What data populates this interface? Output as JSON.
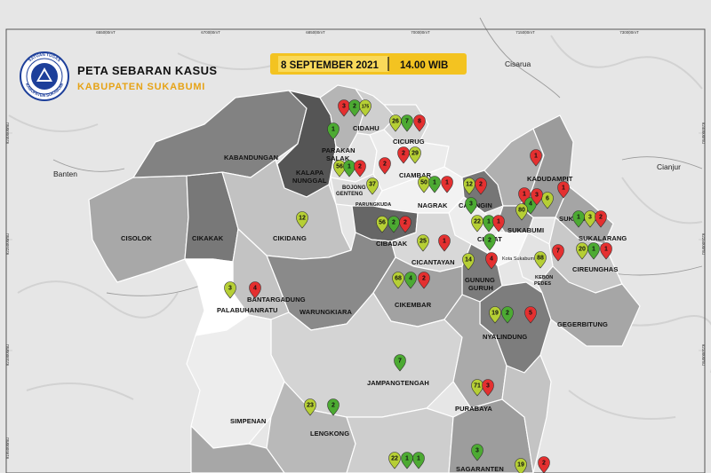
{
  "header": {
    "title": "PETA SEBARAN KASUS",
    "subtitle": "KABUPATEN SUKABUMI",
    "date": "8 SEPTEMBER 2021",
    "time": "14.00 WIB"
  },
  "logo": {
    "ring_text_top": "SATUAN TUGAS",
    "ring_text_bottom": "KABUPATEN SUKABUMI"
  },
  "colors": {
    "pin_red": "#e43030",
    "pin_green": "#4caa32",
    "pin_yellowgreen": "#b6cf35",
    "accent_gold": "#f3c321",
    "logo_blue": "#1d3f9a"
  },
  "grid": {
    "top_ticks": [
      "655000mT",
      "670000mT",
      "685000mT",
      "700000mT",
      "715000mT",
      "730000mT"
    ],
    "left_ticks": [
      "9240000mU",
      "9225000mU",
      "9210000mU",
      "9195000mU",
      "9180000mU"
    ]
  },
  "outside_labels": {
    "banten": "Banten",
    "cianjur": "Cianjur",
    "cisarua": "Cisarua",
    "kota_sukabumi": "Kota Sukabumi"
  },
  "districts": [
    {
      "id": "cidahu",
      "lines": [
        "CIDAHU"
      ]
    },
    {
      "id": "parakansalak",
      "lines": [
        "PARAKAN",
        "SALAK"
      ]
    },
    {
      "id": "cicurug",
      "lines": [
        "CICURUG"
      ]
    },
    {
      "id": "kabandungan",
      "lines": [
        "KABANDUNGAN"
      ]
    },
    {
      "id": "kalapanunggal",
      "lines": [
        "KALAPA",
        "NUNGGAL"
      ]
    },
    {
      "id": "bojonggenteng",
      "lines": [
        "BOJONG",
        "GENTENG"
      ]
    },
    {
      "id": "parungkuda",
      "lines": [
        "PARUNGKUDA"
      ]
    },
    {
      "id": "ciambar",
      "lines": [
        "CIAMBAR"
      ]
    },
    {
      "id": "nagrak",
      "lines": [
        "NAGRAK"
      ]
    },
    {
      "id": "caringin",
      "lines": [
        "CARINGIN"
      ]
    },
    {
      "id": "kadudampit",
      "lines": [
        "KADUDAMPIT"
      ]
    },
    {
      "id": "sukabumi",
      "lines": [
        "SUKABUMI"
      ]
    },
    {
      "id": "sukaraja",
      "lines": [
        "SUKARAJA"
      ]
    },
    {
      "id": "sukalarang",
      "lines": [
        "SUKALARANG"
      ]
    },
    {
      "id": "cireunghas",
      "lines": [
        "CIREUNGHAS"
      ]
    },
    {
      "id": "kebonpedes",
      "lines": [
        "KEBON",
        "PEDES"
      ]
    },
    {
      "id": "cisaat",
      "lines": [
        "CISAAT"
      ]
    },
    {
      "id": "cicantayan",
      "lines": [
        "CICANTAYAN"
      ]
    },
    {
      "id": "gunungguruh",
      "lines": [
        "GUNUNG",
        "GURUH"
      ]
    },
    {
      "id": "cibadak",
      "lines": [
        "CIBADAK"
      ]
    },
    {
      "id": "cikidang",
      "lines": [
        "CIKIDANG"
      ]
    },
    {
      "id": "cisolok",
      "lines": [
        "CISOLOK"
      ]
    },
    {
      "id": "cikakak",
      "lines": [
        "CIKAKAK"
      ]
    },
    {
      "id": "palabuhanratu",
      "lines": [
        "PALABUHANRATU"
      ]
    },
    {
      "id": "bantargadung",
      "lines": [
        "BANTARGADUNG"
      ]
    },
    {
      "id": "warungkiara",
      "lines": [
        "WARUNGKIARA"
      ]
    },
    {
      "id": "cikembar",
      "lines": [
        "CIKEMBAR"
      ]
    },
    {
      "id": "nyalindung",
      "lines": [
        "NYALINDUNG"
      ]
    },
    {
      "id": "gegerbitung",
      "lines": [
        "GEGERBITUNG"
      ]
    },
    {
      "id": "jampangtengah",
      "lines": [
        "JAMPANGTENGAH"
      ]
    },
    {
      "id": "purabaya",
      "lines": [
        "PURABAYA"
      ]
    },
    {
      "id": "simpenan",
      "lines": [
        "SIMPENAN"
      ]
    },
    {
      "id": "lengkong",
      "lines": [
        "LENGKONG"
      ]
    },
    {
      "id": "sagaranten",
      "lines": [
        "SAGARANTEN"
      ]
    }
  ],
  "pins": [
    {
      "color": "red",
      "value": "3"
    },
    {
      "color": "green",
      "value": "2"
    },
    {
      "color": "yellowgreen",
      "value": "175"
    },
    {
      "color": "green",
      "value": "1"
    },
    {
      "color": "yellowgreen",
      "value": "26"
    },
    {
      "color": "green",
      "value": "7"
    },
    {
      "color": "red",
      "value": "8"
    },
    {
      "color": "yellowgreen",
      "value": "56"
    },
    {
      "color": "green",
      "value": "1"
    },
    {
      "color": "red",
      "value": "2"
    },
    {
      "color": "red",
      "value": "2"
    },
    {
      "color": "yellowgreen",
      "value": "37"
    },
    {
      "color": "red",
      "value": "2"
    },
    {
      "color": "yellowgreen",
      "value": "29"
    },
    {
      "color": "yellowgreen",
      "value": "50"
    },
    {
      "color": "green",
      "value": "1"
    },
    {
      "color": "red",
      "value": "1"
    },
    {
      "color": "yellowgreen",
      "value": "12"
    },
    {
      "color": "red",
      "value": "2"
    },
    {
      "color": "green",
      "value": "3"
    },
    {
      "color": "red",
      "value": "1"
    },
    {
      "color": "red",
      "value": "1"
    },
    {
      "color": "yellowgreen",
      "value": "6"
    },
    {
      "color": "green",
      "value": "4"
    },
    {
      "color": "yellowgreen",
      "value": "80"
    },
    {
      "color": "red",
      "value": "3"
    },
    {
      "color": "red",
      "value": "1"
    },
    {
      "color": "green",
      "value": "1"
    },
    {
      "color": "yellowgreen",
      "value": "3"
    },
    {
      "color": "red",
      "value": "2"
    },
    {
      "color": "yellowgreen",
      "value": "20"
    },
    {
      "color": "green",
      "value": "1"
    },
    {
      "color": "red",
      "value": "1"
    },
    {
      "color": "red",
      "value": "7"
    },
    {
      "color": "yellowgreen",
      "value": "22"
    },
    {
      "color": "green",
      "value": "1"
    },
    {
      "color": "red",
      "value": "1"
    },
    {
      "color": "yellowgreen",
      "value": "25"
    },
    {
      "color": "red",
      "value": "1"
    },
    {
      "color": "green",
      "value": "2"
    },
    {
      "color": "yellowgreen",
      "value": "14"
    },
    {
      "color": "red",
      "value": "4"
    },
    {
      "color": "yellowgreen",
      "value": "88"
    },
    {
      "color": "yellowgreen",
      "value": "56"
    },
    {
      "color": "green",
      "value": "2"
    },
    {
      "color": "red",
      "value": "2"
    },
    {
      "color": "yellowgreen",
      "value": "12"
    },
    {
      "color": "yellowgreen",
      "value": "3"
    },
    {
      "color": "red",
      "value": "4"
    },
    {
      "color": "yellowgreen",
      "value": "68"
    },
    {
      "color": "green",
      "value": "4"
    },
    {
      "color": "red",
      "value": "2"
    },
    {
      "color": "yellowgreen",
      "value": "19"
    },
    {
      "color": "green",
      "value": "2"
    },
    {
      "color": "red",
      "value": "5"
    },
    {
      "color": "green",
      "value": "7"
    },
    {
      "color": "yellowgreen",
      "value": "71"
    },
    {
      "color": "red",
      "value": "3"
    },
    {
      "color": "yellowgreen",
      "value": "23"
    },
    {
      "color": "green",
      "value": "2"
    },
    {
      "color": "green",
      "value": "3"
    },
    {
      "color": "yellowgreen",
      "value": "22"
    },
    {
      "color": "green",
      "value": "1"
    },
    {
      "color": "green",
      "value": "1"
    },
    {
      "color": "yellowgreen",
      "value": "19"
    },
    {
      "color": "red",
      "value": "2"
    }
  ]
}
